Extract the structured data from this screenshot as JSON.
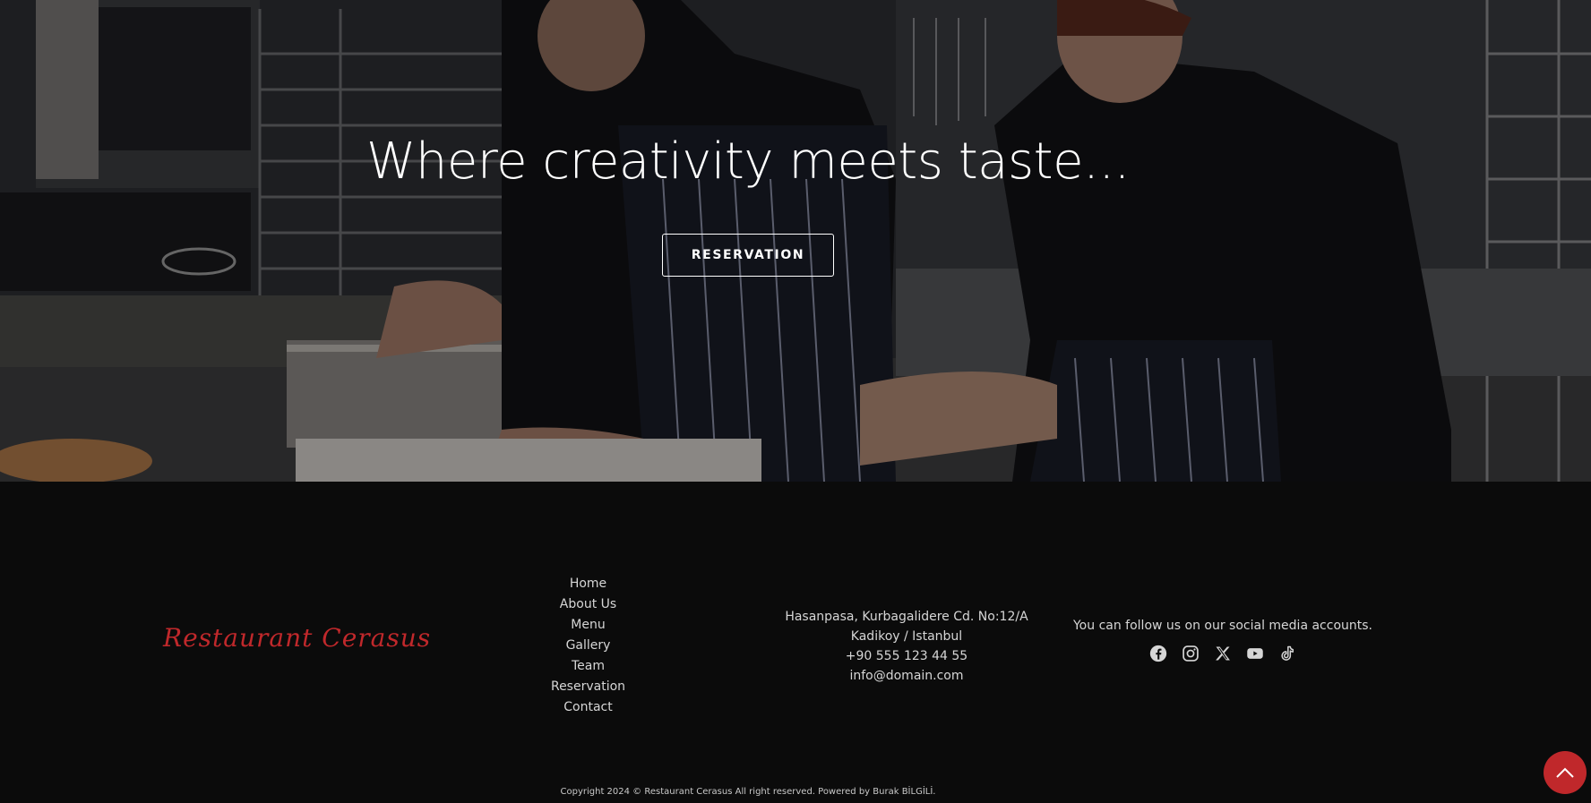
{
  "hero": {
    "title": "Where creativity meets taste...",
    "reservation_label": "RESERVATION"
  },
  "footer": {
    "brand": "Restaurant Cerasus",
    "nav": [
      "Home",
      "About Us",
      "Menu",
      "Gallery",
      "Team",
      "Reservation",
      "Contact"
    ],
    "address": {
      "line1": "Hasanpasa, Kurbagalidere Cd. No:12/A",
      "line2": "Kadikoy / Istanbul",
      "phone": "+90 555 123 44 55",
      "email": "info@domain.com"
    },
    "social_text": "You can follow us on our social media accounts.",
    "social_icons": [
      "facebook-icon",
      "instagram-icon",
      "x-icon",
      "youtube-icon",
      "tiktok-icon"
    ],
    "copyright": "Copyright 2024 © Restaurant Cerasus All right reserved. Powered by Burak BİLGİLİ."
  },
  "colors": {
    "accent": "#c0282b",
    "background": "#0b0b0b",
    "text": "#d6d6d6"
  }
}
